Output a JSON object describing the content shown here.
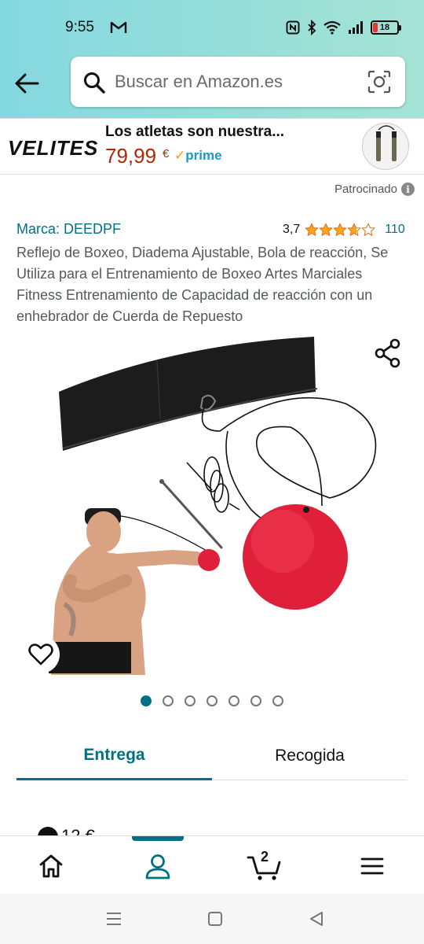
{
  "status_bar": {
    "time": "9:55",
    "battery": "18",
    "battery_fraction": 0.18
  },
  "search": {
    "placeholder": "Buscar en Amazon.es"
  },
  "sponsored_ad": {
    "brand_logo": "VELITES",
    "title": "Los atletas son nuestra...",
    "price": "79,99",
    "currency": "€",
    "prime_label": "prime",
    "sponsored_label": "Patrocinado"
  },
  "product": {
    "brand": "Marca: DEEDPF",
    "rating": "3,7",
    "rating_value": 3.7,
    "rating_count": "110",
    "title": "Reflejo de Boxeo, Diadema Ajustable, Bola de reacción, Se Utiliza para el Entrenamiento de Boxeo Artes Marciales Fitness Entrenamiento de Capacidad de reacción con un enhebrador de Cuerda de Repuesto",
    "image_count": 7,
    "active_image": 1
  },
  "tabs": [
    {
      "label": "Entrega",
      "active": true
    },
    {
      "label": "Recogida",
      "active": false
    }
  ],
  "partial_text": "12 €",
  "bottom_nav": {
    "cart_count": "2",
    "items": [
      "home-icon",
      "account-icon",
      "cart-icon",
      "menu-icon"
    ]
  },
  "colors": {
    "accent": "#007185",
    "price": "#b12704",
    "star": "#ffa41c",
    "header_gradient_start": "#84d8e0",
    "header_gradient_end": "#a5e3d3"
  }
}
